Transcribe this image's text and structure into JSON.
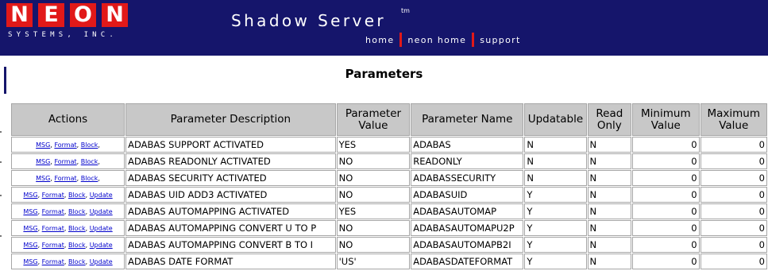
{
  "header": {
    "logo_letters": [
      "N",
      "E",
      "O",
      "N"
    ],
    "logo_subtitle": "SYSTEMS, INC.",
    "product": "Shadow Server",
    "trademark": "tm",
    "nav": [
      {
        "label": "home"
      },
      {
        "label": "neon home"
      },
      {
        "label": "support"
      }
    ]
  },
  "page": {
    "title": "Parameters"
  },
  "colors": {
    "banner": "#15156b",
    "logo_red": "#e11919",
    "header_cell": "#c8c8c8",
    "link": "#0000cc"
  },
  "table": {
    "columns": [
      "Actions",
      "Parameter Description",
      "Parameter Value",
      "Parameter Name",
      "Updatable",
      "Read Only",
      "Minimum Value",
      "Maximum Value"
    ],
    "action_labels": {
      "msg": "MSG",
      "format": "Format",
      "block": "Block",
      "update": "Update"
    },
    "rows": [
      {
        "actions": [
          "MSG",
          "Format",
          "Block"
        ],
        "description": "ADABAS SUPPORT ACTIVATED",
        "value": "YES",
        "name": "ADABAS",
        "updatable": "N",
        "read_only": "N",
        "min": "0",
        "max": "0"
      },
      {
        "actions": [
          "MSG",
          "Format",
          "Block"
        ],
        "description": "ADABAS READONLY ACTIVATED",
        "value": "NO",
        "name": "READONLY",
        "updatable": "N",
        "read_only": "N",
        "min": "0",
        "max": "0"
      },
      {
        "actions": [
          "MSG",
          "Format",
          "Block"
        ],
        "description": "ADABAS SECURITY ACTIVATED",
        "value": "NO",
        "name": "ADABASSECURITY",
        "updatable": "N",
        "read_only": "N",
        "min": "0",
        "max": "0"
      },
      {
        "actions": [
          "MSG",
          "Format",
          "Block",
          "Update"
        ],
        "description": "ADABAS UID ADD3 ACTIVATED",
        "value": "NO",
        "name": "ADABASUID",
        "updatable": "Y",
        "read_only": "N",
        "min": "0",
        "max": "0"
      },
      {
        "actions": [
          "MSG",
          "Format",
          "Block",
          "Update"
        ],
        "description": "ADABAS AUTOMAPPING ACTIVATED",
        "value": "YES",
        "name": "ADABASAUTOMAP",
        "updatable": "Y",
        "read_only": "N",
        "min": "0",
        "max": "0"
      },
      {
        "actions": [
          "MSG",
          "Format",
          "Block",
          "Update"
        ],
        "description": "ADABAS AUTOMAPPING CONVERT U TO P",
        "value": "NO",
        "name": "ADABASAUTOMAPU2P",
        "updatable": "Y",
        "read_only": "N",
        "min": "0",
        "max": "0"
      },
      {
        "actions": [
          "MSG",
          "Format",
          "Block",
          "Update"
        ],
        "description": "ADABAS AUTOMAPPING CONVERT B TO I",
        "value": "NO",
        "name": "ADABASAUTOMAPB2I",
        "updatable": "Y",
        "read_only": "N",
        "min": "0",
        "max": "0"
      },
      {
        "actions": [
          "MSG",
          "Format",
          "Block",
          "Update"
        ],
        "description": "ADABAS DATE FORMAT",
        "value": "'US'",
        "name": "ADABASDATEFORMAT",
        "updatable": "Y",
        "read_only": "N",
        "min": "0",
        "max": "0"
      }
    ]
  }
}
